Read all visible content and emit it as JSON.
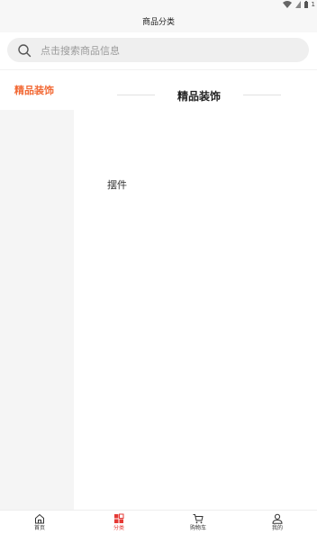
{
  "status_bar": {
    "battery_text": "1"
  },
  "header": {
    "title": "商品分类"
  },
  "search": {
    "placeholder": "点击搜索商品信息"
  },
  "sidebar": {
    "items": [
      {
        "label": "精品装饰",
        "active": true
      }
    ]
  },
  "section": {
    "title": "精品装饰"
  },
  "categories": [
    {
      "label": "摆件"
    }
  ],
  "tabbar": {
    "tabs": [
      {
        "label": "首页",
        "icon": "home-icon",
        "active": false
      },
      {
        "label": "分类",
        "icon": "category-icon",
        "active": true
      },
      {
        "label": "购物车",
        "icon": "cart-icon",
        "active": false
      },
      {
        "label": "我的",
        "icon": "user-icon",
        "active": false
      }
    ]
  },
  "colors": {
    "accent": "#f26a36",
    "tab_active": "#e53935",
    "sidebar_bg": "#f5f5f5"
  }
}
